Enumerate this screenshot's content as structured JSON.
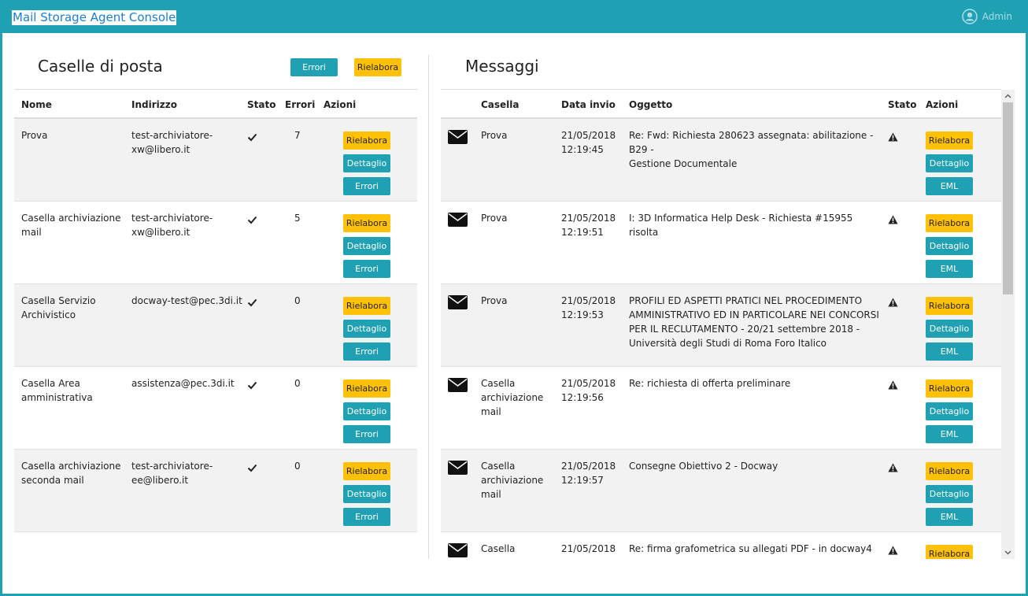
{
  "app": {
    "title": "Mail Storage Agent Console",
    "user": "Admin"
  },
  "mailboxes": {
    "title": "Caselle di posta",
    "btn_errors": "Errori",
    "btn_rework": "Rielabora",
    "headers": [
      "Nome",
      "Indirizzo",
      "Stato",
      "Errori",
      "Azioni"
    ],
    "actions": {
      "rework": "Rielabora",
      "detail": "Dettaglio",
      "errors": "Errori"
    },
    "rows": [
      {
        "name": [
          "Prova"
        ],
        "address": [
          "test-archiviatore-",
          "xw@libero.it"
        ],
        "errors": "7"
      },
      {
        "name": [
          "Casella archiviazione",
          "mail"
        ],
        "address": [
          "test-archiviatore-",
          "xw@libero.it"
        ],
        "errors": "5"
      },
      {
        "name": [
          "Casella Servizio",
          "Archivistico"
        ],
        "address": [
          "docway-test@pec.3di.it"
        ],
        "errors": "0"
      },
      {
        "name": [
          "Casella Area",
          "amministrativa"
        ],
        "address": [
          "assistenza@pec.3di.it"
        ],
        "errors": "0"
      },
      {
        "name": [
          "Casella archiviazione",
          "seconda mail"
        ],
        "address": [
          "test-archiviatore-",
          "ee@libero.it"
        ],
        "errors": "0"
      }
    ]
  },
  "messages": {
    "title": "Messaggi",
    "headers": [
      "Casella",
      "Data invio",
      "Oggetto",
      "Stato",
      "Azioni"
    ],
    "actions": {
      "rework": "Rielabora",
      "detail": "Dettaglio",
      "eml": "EML"
    },
    "rows": [
      {
        "mailbox": [
          "Prova"
        ],
        "date": [
          "21/05/2018",
          "12:19:45"
        ],
        "subject": [
          "Re: Fwd: Richiesta 280623 assegnata: abilitazione - B29 -",
          "Gestione Documentale"
        ]
      },
      {
        "mailbox": [
          "Prova"
        ],
        "date": [
          "21/05/2018",
          "12:19:51"
        ],
        "subject": [
          "I: 3D Informatica Help Desk - Richiesta #15955 risolta"
        ]
      },
      {
        "mailbox": [
          "Prova"
        ],
        "date": [
          "21/05/2018",
          "12:19:53"
        ],
        "subject": [
          "PROFILI ED ASPETTI PRATICI NEL PROCEDIMENTO",
          "AMMINISTRATIVO ED IN PARTICOLARE NEI CONCORSI",
          "PER IL RECLUTAMENTO - 20/21 settembre 2018 -",
          "Università degli Studi di Roma Foro Italico"
        ]
      },
      {
        "mailbox": [
          "Casella",
          "archiviazione",
          "mail"
        ],
        "date": [
          "21/05/2018",
          "12:19:56"
        ],
        "subject": [
          "Re: richiesta di offerta preliminare"
        ]
      },
      {
        "mailbox": [
          "Casella",
          "archiviazione",
          "mail"
        ],
        "date": [
          "21/05/2018",
          "12:19:57"
        ],
        "subject": [
          "Consegne Obiettivo 2 - Docway"
        ]
      },
      {
        "mailbox": [
          "Casella"
        ],
        "date": [
          "21/05/2018"
        ],
        "subject": [
          "Re: firma grafometrica su allegati PDF - in docway4"
        ]
      }
    ]
  }
}
